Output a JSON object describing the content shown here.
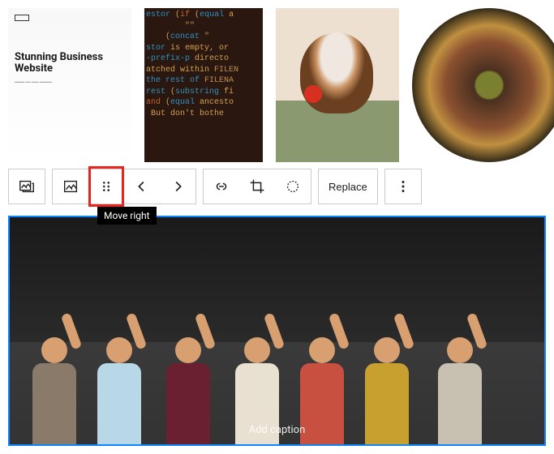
{
  "gallery": {
    "images": [
      {
        "alt": "website-mockup",
        "mockup_heading": "Stunning Business Website"
      },
      {
        "alt": "code-screenshot"
      },
      {
        "alt": "dog-with-ball"
      },
      {
        "alt": "charcuterie-board"
      }
    ]
  },
  "toolbar": {
    "replace_label": "Replace",
    "tooltip": "Move right"
  },
  "selected_image": {
    "caption_placeholder": "Add caption",
    "alt": "group-of-people-cheering"
  },
  "colors": {
    "selection": "#0a84ff",
    "highlight": "#e8251e"
  }
}
